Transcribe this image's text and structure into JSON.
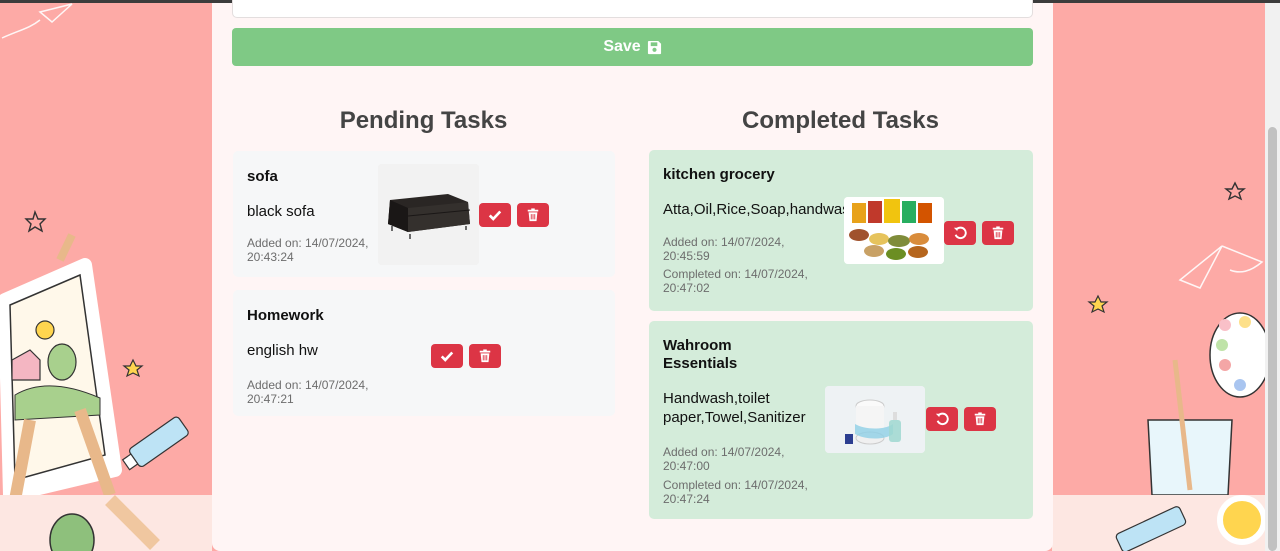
{
  "form": {
    "save_label": "Save"
  },
  "pending": {
    "heading": "Pending Tasks",
    "tasks": [
      {
        "title": "sofa",
        "description": "black sofa",
        "added_label": "Added on: 14/07/2024,",
        "added_time": "20:43:24",
        "has_image": true,
        "image_icon": "black-sofa-image"
      },
      {
        "title": "Homework",
        "description": "english hw",
        "added_label": "Added on: 14/07/2024,",
        "added_time": "20:47:21",
        "has_image": false
      }
    ]
  },
  "completed": {
    "heading": "Completed Tasks",
    "tasks": [
      {
        "title": "kitchen grocery",
        "description": "Atta,Oil,Rice,Soap,handwash",
        "added_label": "Added on: 14/07/2024,",
        "added_time": "20:45:59",
        "completed_label": "Completed on: 14/07/2024,",
        "completed_time": "20:47:02",
        "image_icon": "grocery-image"
      },
      {
        "title_line1": "Wahroom",
        "title_line2": "Essentials",
        "description_line1": "Handwash,toilet",
        "description_line2": "paper,Towel,Sanitizer",
        "added_label": "Added on: 14/07/2024,",
        "added_time": "20:47:00",
        "completed_label": "Completed on: 14/07/2024,",
        "completed_time": "20:47:24",
        "image_icon": "bathroom-essentials-image"
      }
    ]
  },
  "colors": {
    "page_bg": "#fdaaa6",
    "container_bg": "#fff5f5",
    "save_button": "#7fc985",
    "danger_button": "#dc3545",
    "pending_card": "#f6f7f8",
    "completed_card": "#d4ecda"
  }
}
